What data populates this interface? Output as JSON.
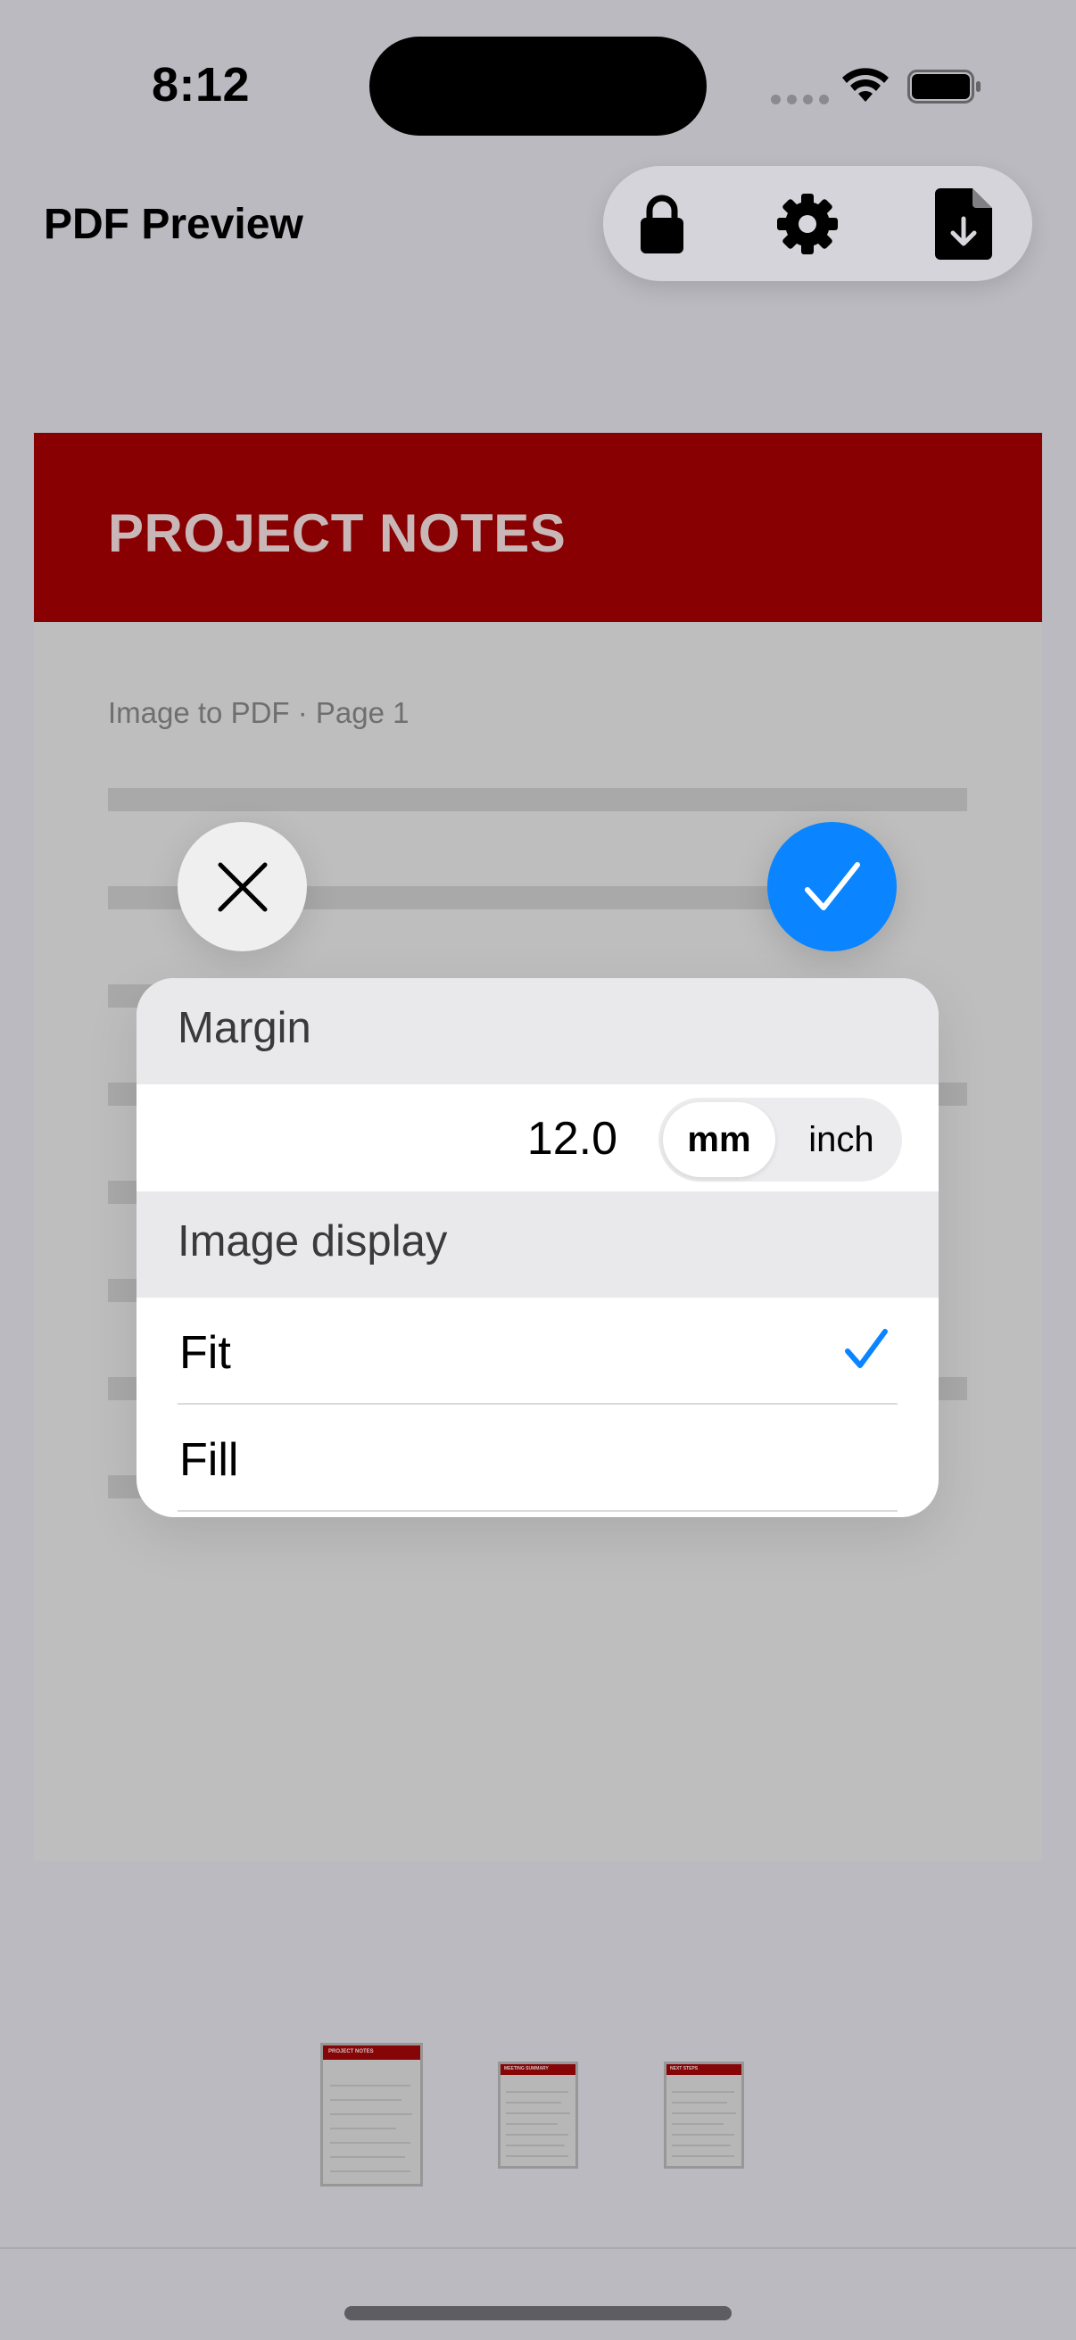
{
  "status_bar": {
    "time": "8:12"
  },
  "nav": {
    "title": "PDF Preview",
    "icons": [
      "lock-icon",
      "gear-icon",
      "file-download-icon"
    ]
  },
  "document": {
    "title": "PROJECT NOTES",
    "subtitle": "Image to PDF · Page 1",
    "header_color": "#880002"
  },
  "popover": {
    "margin_header": "Margin",
    "margin_value": "12.0",
    "units": {
      "selected": "mm",
      "other": "inch"
    },
    "image_display_header": "Image display",
    "options": [
      {
        "label": "Fit",
        "checked": true
      },
      {
        "label": "Fill",
        "checked": false
      }
    ],
    "accent_color": "#0a84ff"
  },
  "thumbnails": [
    {
      "title": "PROJECT NOTES",
      "subtitle": "Image to PDF · Page 1",
      "selected": true
    },
    {
      "title": "MEETING SUMMARY",
      "selected": false
    },
    {
      "title": "NEXT STEPS",
      "selected": false
    }
  ]
}
